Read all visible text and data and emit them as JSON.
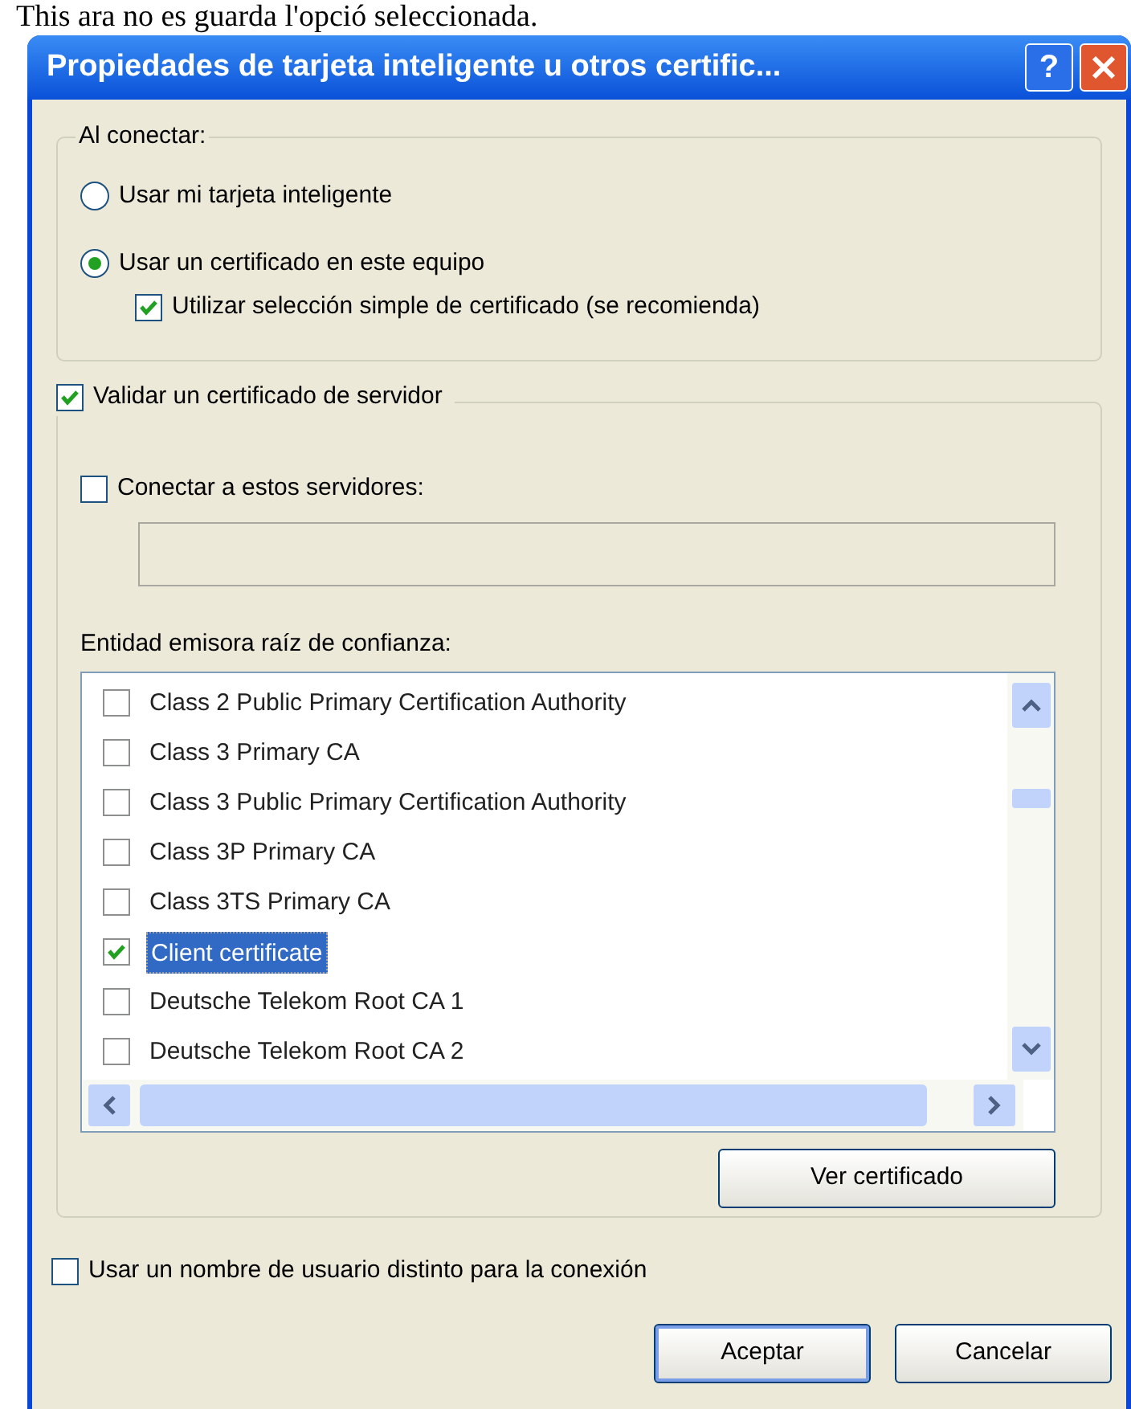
{
  "caption": "This ara no es guarda l'opció seleccionada.",
  "window": {
    "title": "Propiedades de tarjeta inteligente u otros certific...",
    "help": "?"
  },
  "connect_group": {
    "legend": "Al conectar:",
    "options": [
      {
        "label": "Usar mi tarjeta inteligente",
        "selected": false
      },
      {
        "label": "Usar un certificado en este equipo",
        "selected": true
      }
    ],
    "simple_selection": {
      "label": "Utilizar selección simple de certificado (se recomienda)",
      "checked": true
    }
  },
  "server_group": {
    "validate": {
      "label": "Validar un certificado de servidor",
      "checked": true
    },
    "connect_servers": {
      "label": "Conectar a estos servidores:",
      "checked": false
    },
    "servers_field": {
      "disabled": true
    },
    "root_ca_label": "Entidad emisora raíz de confianza:",
    "root_ca_list": [
      {
        "label": "Class 2 Public Primary Certification Authority",
        "checked": false,
        "selected": false
      },
      {
        "label": "Class 3 Primary CA",
        "checked": false,
        "selected": false
      },
      {
        "label": "Class 3 Public Primary Certification Authority",
        "checked": false,
        "selected": false
      },
      {
        "label": "Class 3P Primary CA",
        "checked": false,
        "selected": false
      },
      {
        "label": "Class 3TS Primary CA",
        "checked": false,
        "selected": false
      },
      {
        "label": "Client certificate",
        "checked": true,
        "selected": true
      },
      {
        "label": "Deutsche Telekom Root CA 1",
        "checked": false,
        "selected": false
      },
      {
        "label": "Deutsche Telekom Root CA 2",
        "checked": false,
        "selected": false
      }
    ],
    "view_button": "Ver certificado"
  },
  "different_user": {
    "label": "Usar un nombre de usuario distinto para la conexión",
    "checked": false
  },
  "buttons": [
    {
      "label": "Aceptar",
      "default": true
    },
    {
      "label": "Cancelar",
      "default": false
    }
  ]
}
